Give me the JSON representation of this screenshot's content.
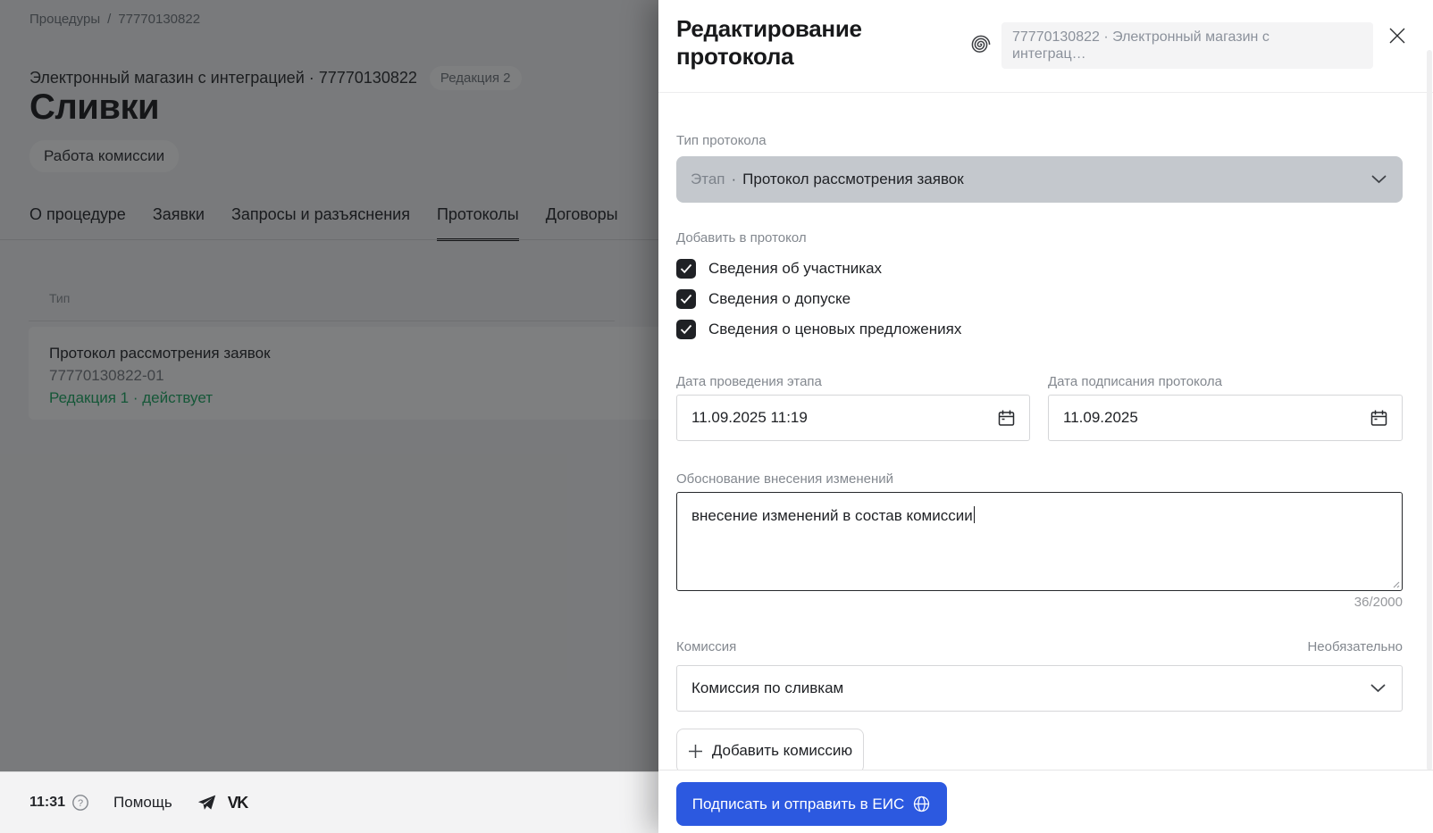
{
  "background": {
    "breadcrumb": {
      "section": "Процедуры",
      "separator": "/",
      "current": "77770130822"
    },
    "subtitle": "Электронный магазин с интеграцией · 77770130822",
    "revision_badge": "Редакция 2",
    "title": "Сливки",
    "status_badge": "Работа комиссии",
    "tabs": [
      {
        "label": "О процедуре",
        "active": false
      },
      {
        "label": "Заявки",
        "active": false
      },
      {
        "label": "Запросы и разъяснения",
        "active": false
      },
      {
        "label": "Протоколы",
        "active": true
      },
      {
        "label": "Договоры",
        "active": false
      }
    ],
    "protocols_table": {
      "col_type": "Тип",
      "row": {
        "title": "Протокол рассмотрения заявок",
        "number": "77770130822-01",
        "status": "Редакция 1 · действует"
      }
    },
    "footer": {
      "time": "11:31",
      "help_label": "Помощь",
      "icons": [
        "help-circle-icon",
        "telegram-icon",
        "vk-icon"
      ]
    }
  },
  "panel": {
    "title": "Редактирование протокола",
    "context_chip": {
      "line1": "77770130822 · Электронный магазин с",
      "line2": "интеграц…"
    },
    "form": {
      "protocol_type": {
        "label": "Тип протокола",
        "value_prefix": "Этап",
        "value_separator": "·",
        "value": "Протокол рассмотрения заявок"
      },
      "add_to_protocol": {
        "label": "Добавить в протокол",
        "options": [
          {
            "label": "Сведения об участниках",
            "checked": true
          },
          {
            "label": "Сведения о допуске",
            "checked": true
          },
          {
            "label": "Сведения о ценовых предложениях",
            "checked": true
          }
        ]
      },
      "stage_date": {
        "label": "Дата проведения этапа",
        "value": "11.09.2025 11:19"
      },
      "signing_date": {
        "label": "Дата подписания протокола",
        "value": "11.09.2025"
      },
      "justification": {
        "label": "Обоснование внесения изменений",
        "value": "внесение изменений в состав комиссии",
        "counter": "36/2000"
      },
      "commission": {
        "label": "Комиссия",
        "optional_hint": "Необязательно",
        "value": "Комиссия по сливкам"
      },
      "add_commission_label": "Добавить комиссию",
      "submit_label": "Подписать и отправить в ЕИС"
    }
  },
  "colors": {
    "accent_blue": "#2c59e0",
    "status_green": "#17a65f",
    "checkbox_bg": "#1f2125",
    "disabled_select_bg": "#c4c8cd",
    "dim_overlay": "rgba(20,21,23,0.55)"
  }
}
